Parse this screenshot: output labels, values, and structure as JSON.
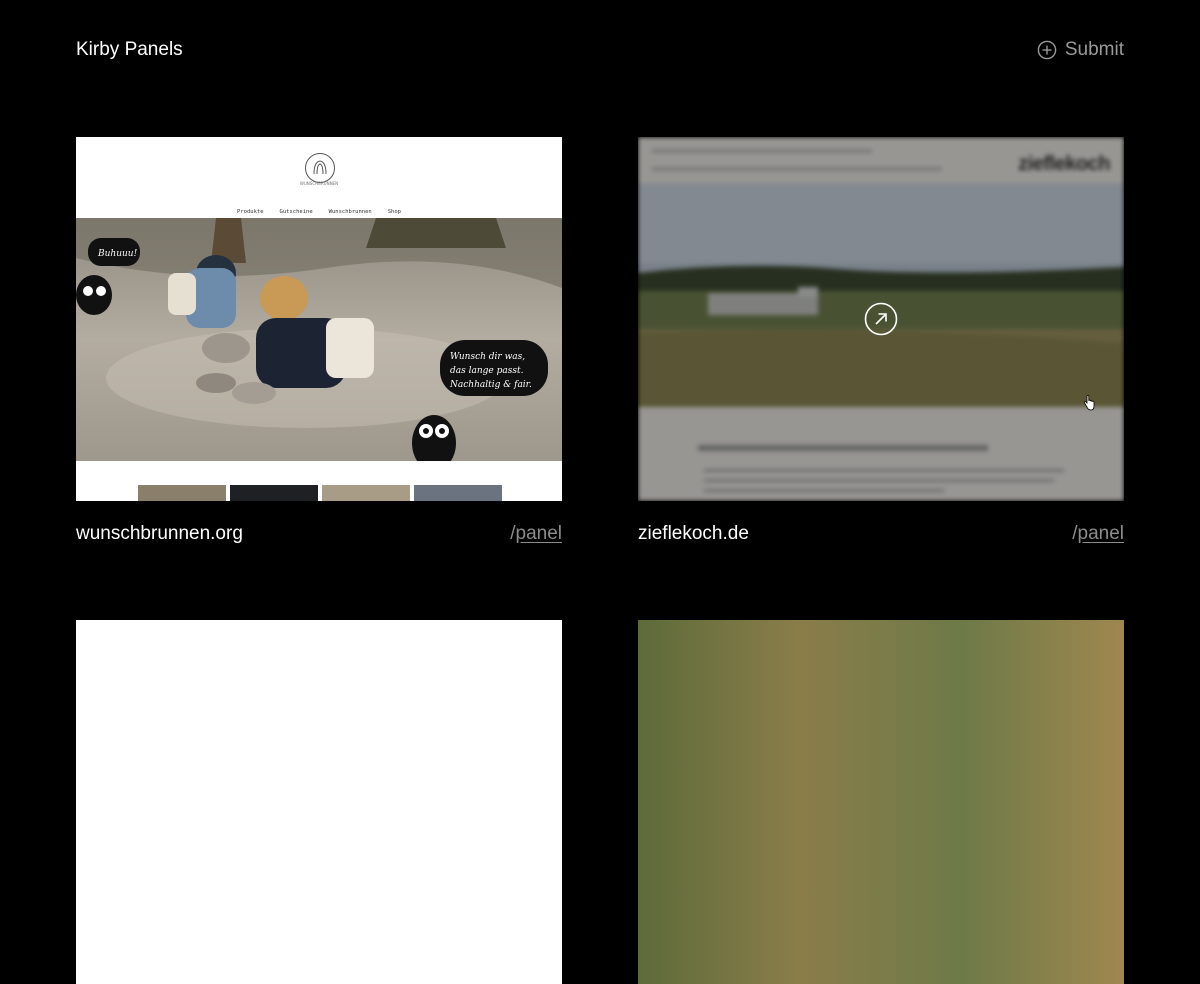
{
  "header": {
    "title": "Kirby Panels",
    "submit_label": "Submit"
  },
  "colors": {
    "background": "#000000",
    "text": "#ffffff",
    "muted": "#8c8c8c"
  },
  "cards": [
    {
      "domain": "wunschbrunnen.org",
      "panel_slash": "/",
      "panel_word": "panel",
      "preview": {
        "logo_text": "WUNSCHBRUNNEN",
        "nav": [
          "Produkte",
          "Gutscheine",
          "Wunschbrunnen",
          "Shop"
        ]
      }
    },
    {
      "domain": "zieflekoch.de",
      "panel_slash": "/",
      "panel_word": "panel",
      "state": "hovered",
      "preview": {
        "logo": "zieflekoch"
      }
    }
  ],
  "icons": {
    "submit": "plus-circle-icon",
    "open": "external-link-arrow-icon",
    "cursor": "hand-pointer-icon"
  }
}
